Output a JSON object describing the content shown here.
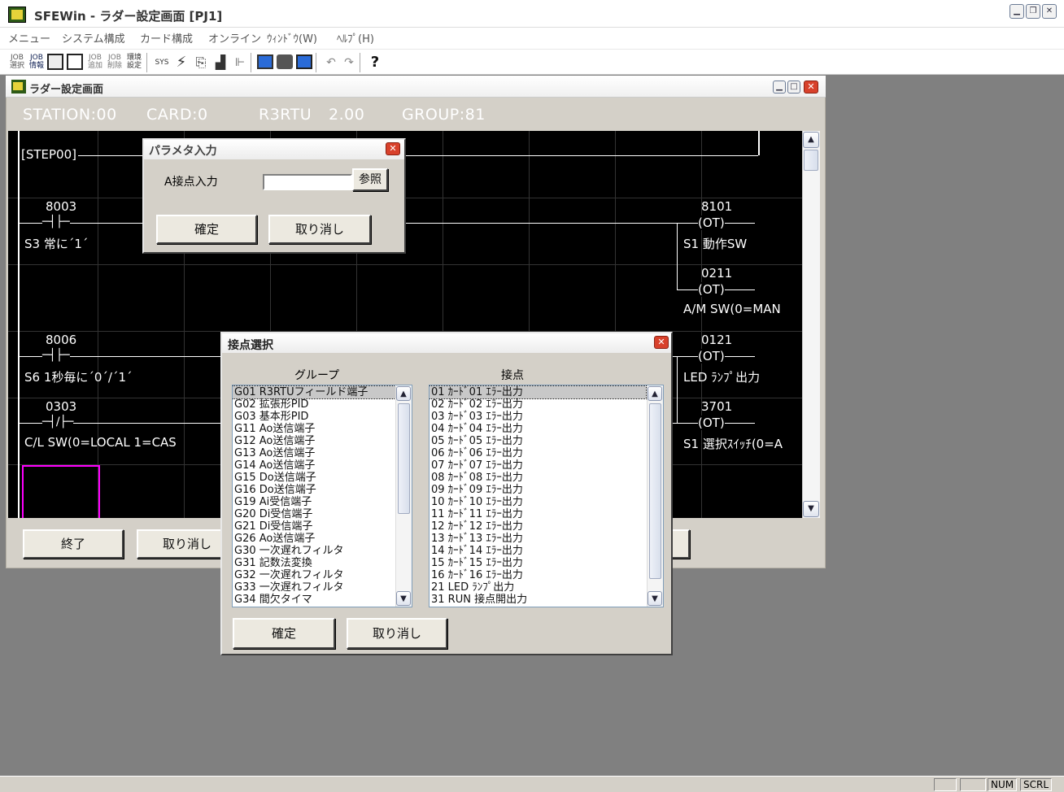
{
  "app": {
    "title": "SFEWin - ラダー設定画面 [PJ1]"
  },
  "menu": [
    "メニュー",
    "システム構成",
    "カード構成",
    "オンライン",
    "ｳｨﾝﾄﾞｳ(W)",
    "ﾍﾙﾌﾟ(H)"
  ],
  "toolbar": [
    "JOB選択",
    "JOB情報",
    "calculator-icon",
    "document-icon",
    "JOB追加",
    "JOB削除",
    "環境設定",
    "SYS",
    "lightning-icon",
    "copy-icon",
    "paste-icon",
    "ladder-icon",
    "monitor-icon",
    "display-icon",
    "window-icon",
    "undo-icon",
    "redo-icon",
    "help-icon"
  ],
  "child": {
    "title": "ラダー設定画面",
    "station": "STATION:00",
    "card": "CARD:0",
    "model": "R3RTU",
    "version": "2.00",
    "group": "GROUP:81"
  },
  "ladder": {
    "step": "[STEP00]",
    "contacts": [
      {
        "addr": "8003",
        "symbol": "─┤├─",
        "comment": "S3 常に´1´"
      },
      {
        "addr": "8006",
        "symbol": "─┤├─",
        "comment": "S6 1秒毎に´0´/´1´"
      },
      {
        "addr": "0303",
        "symbol": "─┤/├─",
        "comment": "C/L SW(0=LOCAL 1=CAS"
      }
    ],
    "coils": [
      {
        "addr": "8101",
        "symbol": "(OT)",
        "comment": "S1 動作SW"
      },
      {
        "addr": "0211",
        "symbol": "(OT)",
        "comment": "A/M SW(0=MAN"
      },
      {
        "addr": "0121",
        "symbol": "(OT)",
        "comment": "LED ﾗﾝﾌﾟ出力"
      },
      {
        "addr": "3701",
        "symbol": "(OT)",
        "comment": "S1 選択ｽｲｯﾁ(0=A"
      }
    ]
  },
  "buttons": {
    "end": "終了",
    "cancel": "取り消し"
  },
  "param_dialog": {
    "title": "パラメタ入力",
    "field_label": "A接点入力",
    "field_value": "",
    "browse": "参照",
    "ok": "確定",
    "cancel": "取り消し"
  },
  "contact_dialog": {
    "title": "接点選択",
    "group_header": "グループ",
    "contact_header": "接点",
    "groups": [
      "G01 R3RTUフィールド端子",
      "G02 拡張形PID",
      "G03 基本形PID",
      "G11 Ao送信端子",
      "G12 Ao送信端子",
      "G13 Ao送信端子",
      "G14 Ao送信端子",
      "G15 Do送信端子",
      "G16 Do送信端子",
      "G19 Ai受信端子",
      "G20 Di受信端子",
      "G21 Di受信端子",
      "G26 Ao送信端子",
      "G30 一次遅れフィルタ",
      "G31 記数法変換",
      "G32 一次遅れフィルタ",
      "G33 一次遅れフィルタ",
      "G34 間欠タイマ"
    ],
    "contacts": [
      "01 ｶｰﾄﾞ01 ｴﾗｰ出力",
      "02 ｶｰﾄﾞ02 ｴﾗｰ出力",
      "03 ｶｰﾄﾞ03 ｴﾗｰ出力",
      "04 ｶｰﾄﾞ04 ｴﾗｰ出力",
      "05 ｶｰﾄﾞ05 ｴﾗｰ出力",
      "06 ｶｰﾄﾞ06 ｴﾗｰ出力",
      "07 ｶｰﾄﾞ07 ｴﾗｰ出力",
      "08 ｶｰﾄﾞ08 ｴﾗｰ出力",
      "09 ｶｰﾄﾞ09 ｴﾗｰ出力",
      "10 ｶｰﾄﾞ10 ｴﾗｰ出力",
      "11 ｶｰﾄﾞ11 ｴﾗｰ出力",
      "12 ｶｰﾄﾞ12 ｴﾗｰ出力",
      "13 ｶｰﾄﾞ13 ｴﾗｰ出力",
      "14 ｶｰﾄﾞ14 ｴﾗｰ出力",
      "15 ｶｰﾄﾞ15 ｴﾗｰ出力",
      "16 ｶｰﾄﾞ16 ｴﾗｰ出力",
      "21 LED ﾗﾝﾌﾟ出力",
      "31 RUN 接点開出力"
    ],
    "ok": "確定",
    "cancel": "取り消し"
  },
  "statusbar": {
    "num": "NUM",
    "scrl": "SCRL"
  }
}
